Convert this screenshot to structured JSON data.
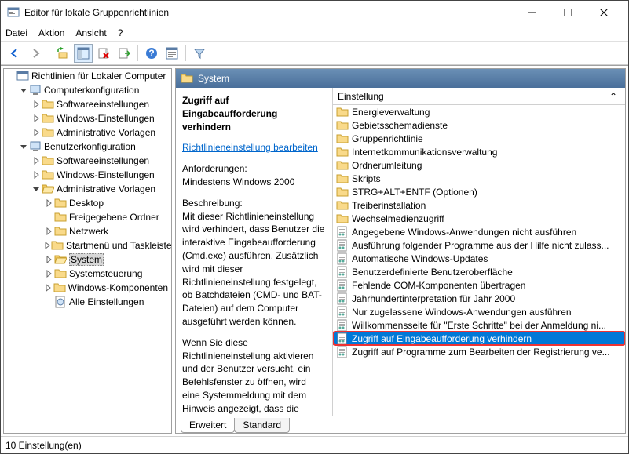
{
  "window": {
    "title": "Editor für lokale Gruppenrichtlinien"
  },
  "menu": {
    "file": "Datei",
    "action": "Aktion",
    "view": "Ansicht",
    "help": "?"
  },
  "tree": {
    "root": "Richtlinien für Lokaler Computer",
    "cc": "Computerkonfiguration",
    "cc_sw": "Softwareeinstellungen",
    "cc_win": "Windows-Einstellungen",
    "cc_adm": "Administrative Vorlagen",
    "uc": "Benutzerkonfiguration",
    "uc_sw": "Softwareeinstellungen",
    "uc_win": "Windows-Einstellungen",
    "uc_adm": "Administrative Vorlagen",
    "uc_desk": "Desktop",
    "uc_share": "Freigegebene Ordner",
    "uc_net": "Netzwerk",
    "uc_start": "Startmenü und Taskleiste",
    "uc_sys": "System",
    "uc_ctrl": "Systemsteuerung",
    "uc_wincomp": "Windows-Komponenten",
    "uc_all": "Alle Einstellungen"
  },
  "header": {
    "title": "System"
  },
  "desc": {
    "title": "Zugriff auf Eingabeaufforderung verhindern",
    "editlink": "Richtlinieneinstellung bearbeiten",
    "req_label": "Anforderungen:",
    "req_text": "Mindestens Windows 2000",
    "desc_label": "Beschreibung:",
    "desc_text": "Mit dieser Richtlinieneinstellung wird verhindert, dass Benutzer die interaktive Eingabeaufforderung (Cmd.exe) ausführen.  Zusätzlich wird mit dieser Richtlinieneinstellung festgelegt, ob Batchdateien (CMD- und BAT-Dateien) auf dem Computer ausgeführt werden können.",
    "desc_text2": "Wenn Sie diese Richtlinieneinstellung aktivieren und der Benutzer versucht, ein Befehlsfenster zu öffnen, wird eine Systemmeldung mit dem Hinweis angezeigt, dass die Aktion aufgrund einer Richtlinieneinstellung nicht"
  },
  "settings": {
    "header": "Einstellung",
    "folders": [
      "Energieverwaltung",
      "Gebietsschemadienste",
      "Gruppenrichtlinie",
      "Internetkommunikationsverwaltung",
      "Ordnerumleitung",
      "Skripts",
      "STRG+ALT+ENTF (Optionen)",
      "Treiberinstallation",
      "Wechselmedienzugriff"
    ],
    "policies": [
      "Angegebene Windows-Anwendungen nicht ausführen",
      "Ausführung folgender Programme aus der Hilfe nicht zulass...",
      "Automatische Windows-Updates",
      "Benutzerdefinierte Benutzeroberfläche",
      "Fehlende COM-Komponenten übertragen",
      "Jahrhundertinterpretation für Jahr 2000",
      "Nur zugelassene Windows-Anwendungen ausführen",
      "Willkommensseite für \"Erste Schritte\" bei der Anmeldung ni...",
      "Zugriff auf Eingabeaufforderung verhindern",
      "Zugriff auf Programme zum Bearbeiten der Registrierung ve..."
    ],
    "selected": "Zugriff auf Eingabeaufforderung verhindern"
  },
  "tabs": {
    "ext": "Erweitert",
    "std": "Standard"
  },
  "status": {
    "text": "10 Einstellung(en)"
  }
}
